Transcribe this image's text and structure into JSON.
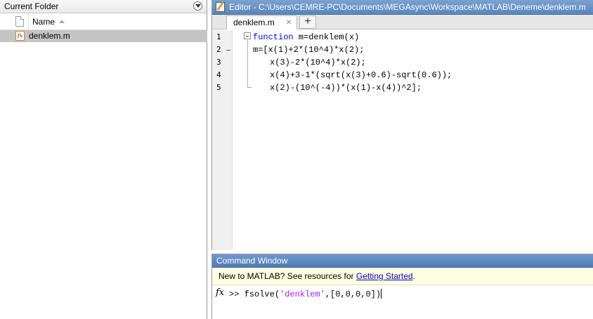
{
  "folder_panel": {
    "title": "Current Folder",
    "column_name": "Name",
    "files": [
      {
        "name": "denklem.m",
        "icon": "matlab-function-file-icon"
      }
    ]
  },
  "editor": {
    "title": "Editor - C:\\Users\\CEMRE-PC\\Documents\\MEGAsync\\Workspace\\MATLAB\\Deneme\\denklem.m",
    "tab_label": "denklem.m",
    "tab_close": "×",
    "tab_add": "+",
    "lines": [
      {
        "num": "1",
        "kw": "function",
        "text": " m=denklem(x)",
        "marker": ""
      },
      {
        "num": "2",
        "kw": "",
        "text": "m=[x(1)+2*(10^4)*x(2);",
        "marker": "–"
      },
      {
        "num": "3",
        "kw": "",
        "text": "x(3)-2*(10^4)*x(2);",
        "marker": ""
      },
      {
        "num": "4",
        "kw": "",
        "text": "x(4)+3-1*(sqrt(x(3)+0.6)-sqrt(0.6));",
        "marker": ""
      },
      {
        "num": "5",
        "kw": "",
        "text": "x(2)-(10^(-4))*(x(1)-x(4))^2];",
        "marker": ""
      }
    ]
  },
  "command_window": {
    "title": "Command Window",
    "banner_text": "New to MATLAB? See resources for ",
    "banner_link": "Getting Started",
    "banner_end": ".",
    "prompt": ">> ",
    "cmd_func": "fsolve(",
    "cmd_string": "'denklem'",
    "cmd_rest": ",[0,0,0,0])",
    "fx_label": "fx"
  }
}
